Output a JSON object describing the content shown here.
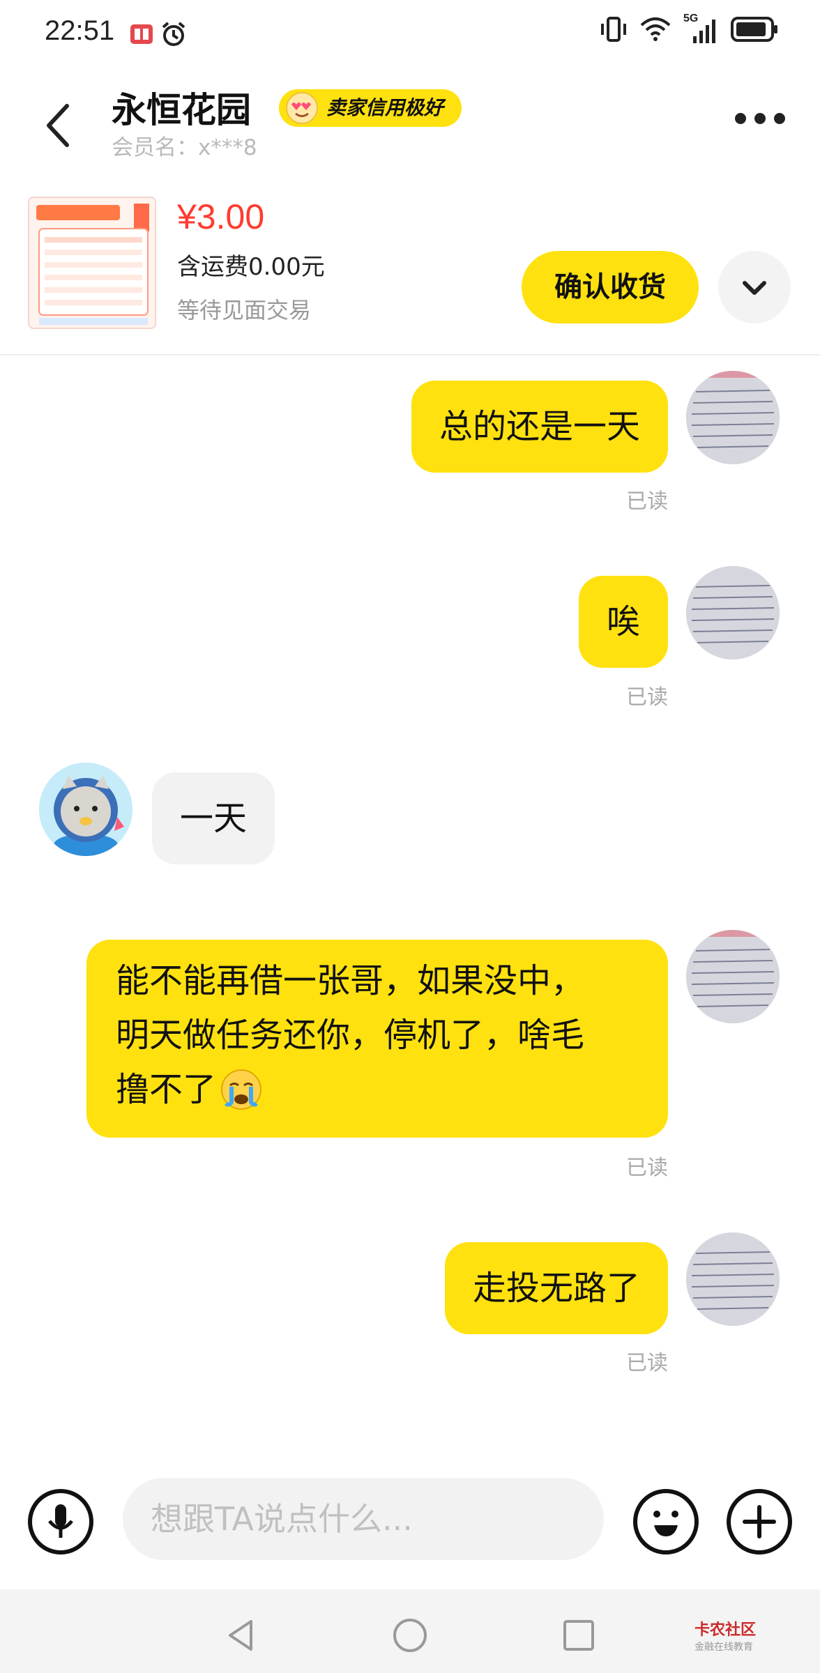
{
  "status_bar": {
    "time": "22:51",
    "network": "5G",
    "icons": [
      "book-icon",
      "alarm-icon",
      "vibrate-icon",
      "wifi-icon",
      "signal-icon",
      "battery-icon"
    ]
  },
  "header": {
    "title": "永恒花园",
    "badge": "卖家信用极好",
    "member_label": "会员名：x***8"
  },
  "product": {
    "price": "¥3.00",
    "shipping": "含运费0.00元",
    "status": "等待见面交易",
    "confirm_button": "确认收货"
  },
  "messages": [
    {
      "sender": "me",
      "text": "总的还是一天",
      "read": "已读"
    },
    {
      "sender": "me",
      "text": "唉",
      "read": "已读"
    },
    {
      "sender": "other",
      "text": "一天"
    },
    {
      "sender": "me",
      "lines": [
        "能不能再借一张哥，如果没中，",
        "明天做任务还你，停机了，啥毛",
        "撸不了"
      ],
      "emoji": "crying-face-icon",
      "read": "已读"
    },
    {
      "sender": "me",
      "text": "走投无路了",
      "read": "已读"
    }
  ],
  "input": {
    "placeholder": "想跟TA说点什么..."
  },
  "watermark": {
    "title": "卡农社区",
    "subtitle": "金融在线教育"
  },
  "colors": {
    "accent": "#ffe10f",
    "price": "#ff3b30",
    "read": "#a9a9a9"
  }
}
